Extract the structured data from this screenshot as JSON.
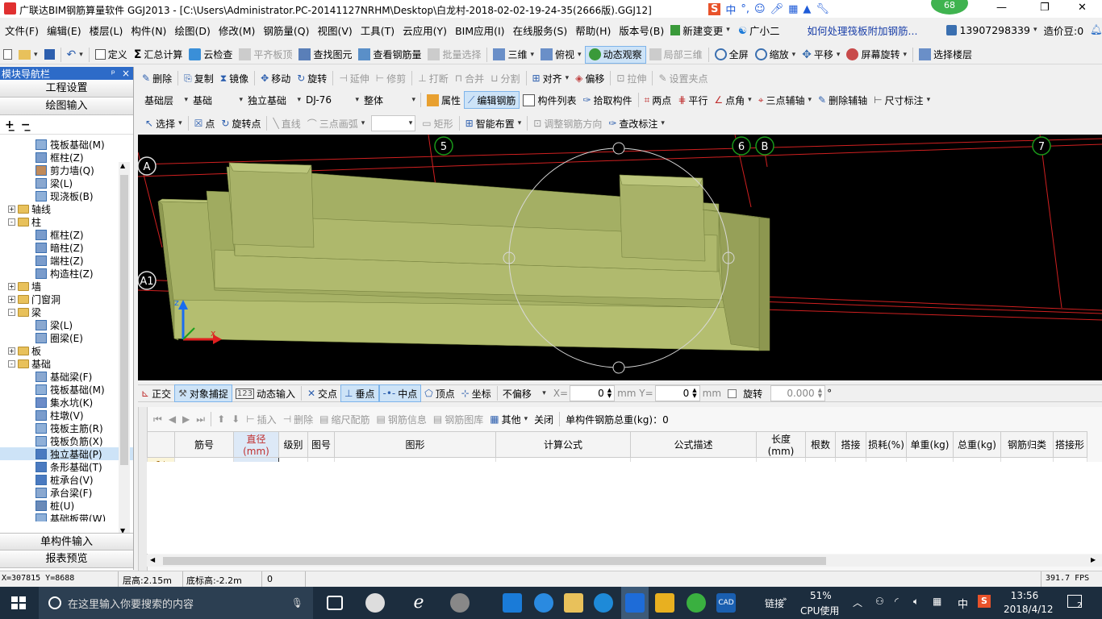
{
  "window": {
    "title": "广联达BIM钢筋算量软件 GGJ2013 - [C:\\Users\\Administrator.PC-20141127NRHM\\Desktop\\白龙村-2018-02-02-19-24-35(2666版).GGJ12]",
    "badge": "68",
    "controls": [
      "—",
      "❐",
      "✕"
    ]
  },
  "menu": {
    "items": [
      "文件(F)",
      "编辑(E)",
      "楼层(L)",
      "构件(N)",
      "绘图(D)",
      "修改(M)",
      "钢筋量(Q)",
      "视图(V)",
      "工具(T)",
      "云应用(Y)",
      "BIM应用(I)",
      "在线服务(S)",
      "帮助(H)",
      "版本号(B)"
    ],
    "new_change": "新建变更",
    "guangxiaoer": "广小二",
    "question": "如何处理筏板附加钢筋...",
    "phone": "13907298339",
    "zaojiadou": "造价豆:0"
  },
  "toolbar1": {
    "items": [
      "定义",
      "汇总计算",
      "云检查",
      "平齐板顶",
      "查找图元",
      "查看钢筋量",
      "批量选择",
      "三维",
      "俯视",
      "动态观察",
      "局部三维",
      "全屏",
      "缩放",
      "平移",
      "屏幕旋转",
      "选择楼层"
    ]
  },
  "toolbar2": {
    "items": [
      "删除",
      "复制",
      "镜像",
      "移动",
      "旋转",
      "延伸",
      "修剪",
      "打断",
      "合并",
      "分割",
      "对齐",
      "偏移",
      "拉伸",
      "设置夹点"
    ]
  },
  "toolbar3": {
    "floor": "基础层",
    "category": "基础",
    "type": "独立基础",
    "component": "DJ-76",
    "scope": "整体",
    "items": [
      "属性",
      "编辑钢筋",
      "构件列表",
      "拾取构件",
      "两点",
      "平行",
      "点角",
      "三点辅轴",
      "删除辅轴",
      "尺寸标注"
    ]
  },
  "toolbar4": {
    "items": [
      "选择",
      "点",
      "旋转点",
      "直线",
      "三点画弧",
      "矩形",
      "智能布置",
      "调整钢筋方向",
      "查改标注"
    ]
  },
  "nav": {
    "title": "模块导航栏",
    "pin": "ᵖ",
    "close": "×",
    "btn_project": "工程设置",
    "btn_draw": "绘图输入",
    "btn_single": "单构件输入",
    "btn_report": "报表预览",
    "tree": [
      {
        "label": "筏板基础(M)",
        "level": 2,
        "icon": "slab"
      },
      {
        "label": "框柱(Z)",
        "level": 2,
        "icon": "col"
      },
      {
        "label": "剪力墙(Q)",
        "level": 2,
        "icon": "wall"
      },
      {
        "label": "梁(L)",
        "level": 2,
        "icon": "beam"
      },
      {
        "label": "现浇板(B)",
        "level": 2,
        "icon": "slab"
      },
      {
        "label": "轴线",
        "level": 0,
        "expand": "+"
      },
      {
        "label": "柱",
        "level": 0,
        "expand": "-"
      },
      {
        "label": "框柱(Z)",
        "level": 2,
        "icon": "col"
      },
      {
        "label": "暗柱(Z)",
        "level": 2,
        "icon": "col"
      },
      {
        "label": "端柱(Z)",
        "level": 2,
        "icon": "col"
      },
      {
        "label": "构造柱(Z)",
        "level": 2,
        "icon": "col"
      },
      {
        "label": "墙",
        "level": 0,
        "expand": "+"
      },
      {
        "label": "门窗洞",
        "level": 0,
        "expand": "+"
      },
      {
        "label": "梁",
        "level": 0,
        "expand": "-"
      },
      {
        "label": "梁(L)",
        "level": 2,
        "icon": "beam"
      },
      {
        "label": "圈梁(E)",
        "level": 2,
        "icon": "beam"
      },
      {
        "label": "板",
        "level": 0,
        "expand": "+"
      },
      {
        "label": "基础",
        "level": 0,
        "expand": "-"
      },
      {
        "label": "基础梁(F)",
        "level": 2,
        "icon": "beam"
      },
      {
        "label": "筏板基础(M)",
        "level": 2,
        "icon": "slab"
      },
      {
        "label": "集水坑(K)",
        "level": 2,
        "icon": "pit"
      },
      {
        "label": "柱墩(V)",
        "level": 2,
        "icon": "col"
      },
      {
        "label": "筏板主筋(R)",
        "level": 2,
        "icon": "slab"
      },
      {
        "label": "筏板负筋(X)",
        "level": 2,
        "icon": "slab"
      },
      {
        "label": "独立基础(P)",
        "level": 2,
        "icon": "found",
        "selected": true
      },
      {
        "label": "条形基础(T)",
        "level": 2,
        "icon": "found"
      },
      {
        "label": "桩承台(V)",
        "level": 2,
        "icon": "found"
      },
      {
        "label": "承台梁(F)",
        "level": 2,
        "icon": "beam"
      },
      {
        "label": "桩(U)",
        "level": 2,
        "icon": "pile"
      },
      {
        "label": "基础板带(W)",
        "level": 2,
        "icon": "slab"
      }
    ]
  },
  "viewport": {
    "axis_labels": [
      "5",
      "6",
      "B",
      "7",
      "A",
      "A1"
    ]
  },
  "snapbar": {
    "items": [
      "正交",
      "对象捕捉",
      "动态输入",
      "交点",
      "垂点",
      "中点",
      "顶点",
      "坐标"
    ],
    "offset": "不偏移",
    "x_label": "X=",
    "x_val": "0",
    "y_label": "mm Y=",
    "y_val": "0",
    "mm": "mm",
    "rotate_label": "旋转",
    "rotate_val": "0.000",
    "deg": "°"
  },
  "rebar_toolbar": {
    "items": [
      "插入",
      "删除",
      "缩尺配筋",
      "钢筋信息",
      "钢筋图库",
      "其他",
      "关闭"
    ],
    "total": "单构件钢筋总重(kg)：0"
  },
  "table": {
    "headers": [
      "筋号",
      "直径(mm)",
      "级别",
      "图号",
      "图形",
      "计算公式",
      "公式描述",
      "长度(mm)",
      "根数",
      "搭接",
      "损耗(%)",
      "单重(kg)",
      "总重(kg)",
      "钢筋归类",
      "搭接形"
    ],
    "row1": "1*"
  },
  "status": {
    "coords": "X=307815 Y=8688",
    "floor_height": "层高:2.15m",
    "base_height": "底标高:-2.2m",
    "zero": "0",
    "fps": "391.7 FPS"
  },
  "taskbar": {
    "search": "在这里输入你要搜索的内容",
    "link": "链接",
    "cpu_pct": "51%",
    "cpu_label": "CPU使用",
    "ime": "中",
    "time": "13:56",
    "date": "2018/4/12",
    "notif": "2"
  }
}
